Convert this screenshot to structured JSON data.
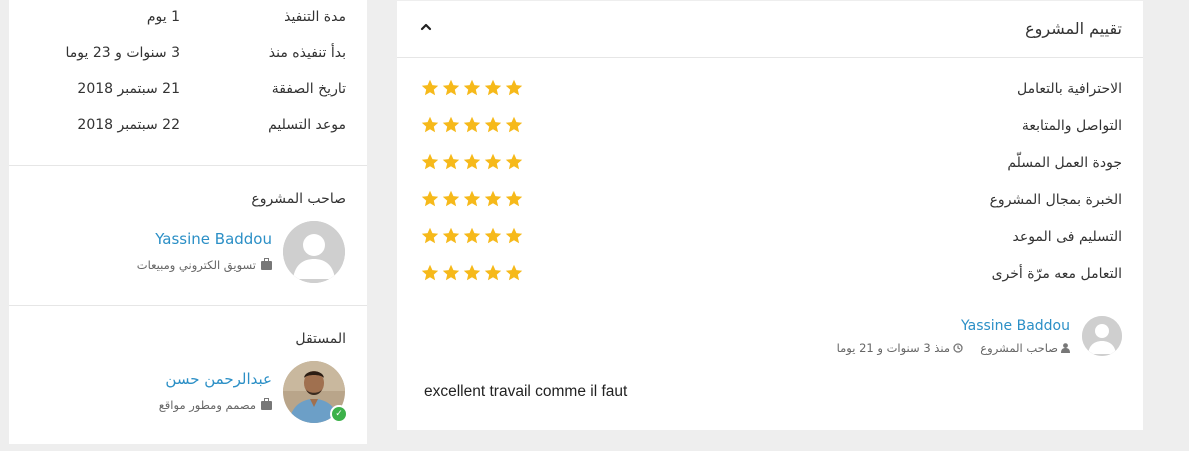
{
  "project_info": {
    "rows": [
      {
        "label": "مدة التنفيذ",
        "value": "1 يوم"
      },
      {
        "label": "بدأ تنفيذه منذ",
        "value": "3 سنوات و 23 يوما"
      },
      {
        "label": "تاريخ الصفقة",
        "value": "21 سبتمبر 2018"
      },
      {
        "label": "موعد التسليم",
        "value": "22 سبتمبر 2018"
      }
    ]
  },
  "owner": {
    "title": "صاحب المشروع",
    "name": "Yassine Baddou",
    "role": "تسويق الكتروني ومبيعات",
    "avatar_icon": "default-user-avatar"
  },
  "freelancer": {
    "title": "المستقل",
    "name": "عبدالرحمن حسن",
    "role": "مصمم ومطور مواقع",
    "online": true,
    "status_icon": "online-check-icon"
  },
  "rating": {
    "title": "تقييم المشروع",
    "collapse_icon": "chevron-up-icon",
    "star_color": "#f6b91a",
    "items": [
      {
        "label": "الاحترافية بالتعامل",
        "stars": 5
      },
      {
        "label": "التواصل والمتابعة",
        "stars": 5
      },
      {
        "label": "جودة العمل المسلّم",
        "stars": 5
      },
      {
        "label": "الخبرة بمجال المشروع",
        "stars": 5
      },
      {
        "label": "التسليم فى الموعد",
        "stars": 5
      },
      {
        "label": "التعامل معه مرّة أخرى",
        "stars": 5
      }
    ]
  },
  "review": {
    "reviewer_name": "Yassine Baddou",
    "reviewer_role": "صاحب المشروع",
    "time": "منذ 3 سنوات و 21 يوما",
    "text": "excellent travail comme il faut"
  },
  "colors": {
    "link": "#2b8fc6",
    "star": "#f6b91a",
    "online": "#3cb14a"
  }
}
